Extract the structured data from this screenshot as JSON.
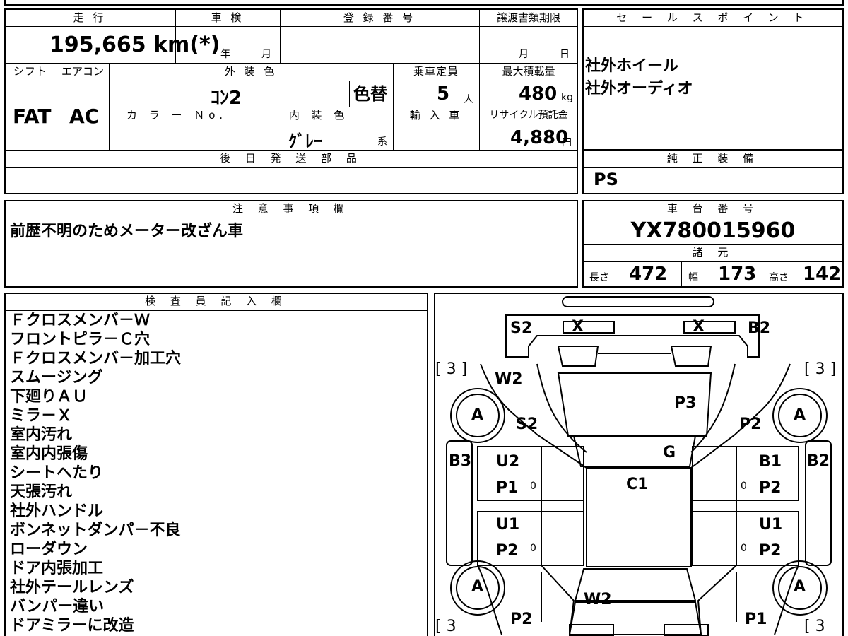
{
  "form": {
    "mileage_header": "走 行",
    "mileage_value": "195,665 km(*)",
    "inspection_header": "車 検",
    "inspection_year": "年",
    "inspection_month": "月",
    "registration_header": "登 録 番 号",
    "transfer_deadline_header": "譲渡書類期限",
    "transfer_month": "月",
    "transfer_day": "日",
    "shift_header": "シフト",
    "shift_value": "FAT",
    "aircon_header": "エアコン",
    "aircon_value": "AC",
    "exterior_color_header": "外 装 色",
    "exterior_color_value": "ｺﾝ2",
    "repaint_label": "色替",
    "capacity_header": "乗車定員",
    "capacity_value": "5",
    "capacity_unit": "人",
    "max_load_header": "最大積載量",
    "max_load_value": "480",
    "max_load_unit": "kg",
    "color_no_header": "カ ラ ー Ｎo.",
    "interior_color_header": "内 装 色",
    "interior_color_value": "ｸﾞﾚｰ",
    "interior_color_suffix": "系",
    "import_header": "輸 入 車",
    "recycle_header": "リサイクル預託金",
    "recycle_value": "4,880",
    "recycle_unit": "円",
    "later_parts_header": "後 日 発 送 部 品",
    "sales_point_header": "セ ー ル ス ポ イ ン ト",
    "sales_points": [
      "社外ホイール",
      "社外オーディオ"
    ],
    "genuine_equipment_header": "純 正 装 備",
    "genuine_equipment_value": "PS",
    "notes_header": "注 意 事 項 欄",
    "notes_value": "前歴不明のためメーター改ざん車",
    "chassis_header": "車 台 番 号",
    "chassis_value": "YX780015960",
    "specs_header": "諸 元",
    "length_label": "長さ",
    "length_value": "472",
    "width_label": "幅",
    "width_value": "173",
    "height_label": "高さ",
    "height_value": "142",
    "inspector_header": "検 査 員 記 入 欄",
    "inspector_notes": [
      "Ｆクロスメンバ－Ｗ",
      "フロントピラ－Ｃ穴",
      "Ｆクロスメンバ－加工穴",
      "スムージング",
      "下廻りＡＵ",
      "ミラ－Ｘ",
      "室内汚れ",
      "室内内張傷",
      "シートへたり",
      "天張汚れ",
      "社外ハンドル",
      "ボンネットダンパ－不良",
      "ローダウン",
      "ドア内張加工",
      "社外テールレンズ",
      "バンパー違い",
      "ドアミラーに改造"
    ]
  },
  "diagram": {
    "s2_top": "S2",
    "x_left": "X",
    "x_right": "X",
    "b2_top": "B2",
    "bracket_tl": "[ 3 ]",
    "bracket_tr": "[ 3 ]",
    "bracket_bl": "[ 3",
    "bracket_br": "[ 3",
    "w2_top": "W2",
    "p3": "P3",
    "a_fl": "A",
    "a_fr": "A",
    "s2_left": "S2",
    "p2_right": "P2",
    "g": "G",
    "b3": "B3",
    "b2_right": "B2",
    "u2": "U2",
    "b1": "B1",
    "p1_left": "P1",
    "c1": "C1",
    "p2_mr": "P2",
    "u1_left": "U1",
    "u1_right": "U1",
    "p2_left": "P2",
    "p2_right2": "P2",
    "a_rl": "A",
    "a_rr": "A",
    "w2_bottom": "W2",
    "p2_bottom": "P2",
    "p1_bottom": "P1",
    "tick": "0"
  }
}
